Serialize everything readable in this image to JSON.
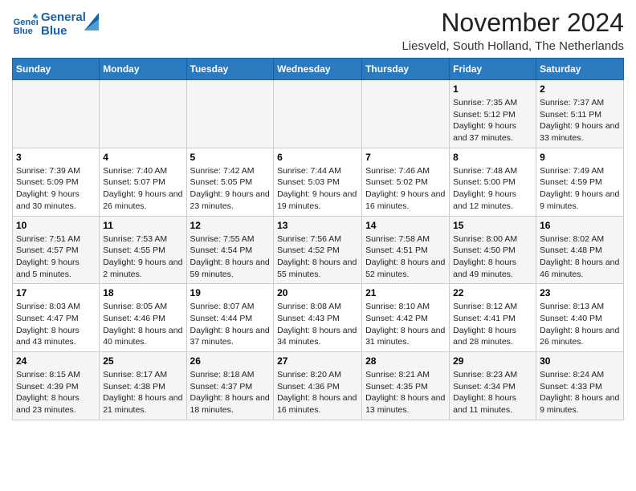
{
  "logo": {
    "text_general": "General",
    "text_blue": "Blue"
  },
  "header": {
    "month_title": "November 2024",
    "location": "Liesveld, South Holland, The Netherlands"
  },
  "weekdays": [
    "Sunday",
    "Monday",
    "Tuesday",
    "Wednesday",
    "Thursday",
    "Friday",
    "Saturday"
  ],
  "weeks": [
    [
      {
        "day": "",
        "info": ""
      },
      {
        "day": "",
        "info": ""
      },
      {
        "day": "",
        "info": ""
      },
      {
        "day": "",
        "info": ""
      },
      {
        "day": "",
        "info": ""
      },
      {
        "day": "1",
        "info": "Sunrise: 7:35 AM\nSunset: 5:12 PM\nDaylight: 9 hours and 37 minutes."
      },
      {
        "day": "2",
        "info": "Sunrise: 7:37 AM\nSunset: 5:11 PM\nDaylight: 9 hours and 33 minutes."
      }
    ],
    [
      {
        "day": "3",
        "info": "Sunrise: 7:39 AM\nSunset: 5:09 PM\nDaylight: 9 hours and 30 minutes."
      },
      {
        "day": "4",
        "info": "Sunrise: 7:40 AM\nSunset: 5:07 PM\nDaylight: 9 hours and 26 minutes."
      },
      {
        "day": "5",
        "info": "Sunrise: 7:42 AM\nSunset: 5:05 PM\nDaylight: 9 hours and 23 minutes."
      },
      {
        "day": "6",
        "info": "Sunrise: 7:44 AM\nSunset: 5:03 PM\nDaylight: 9 hours and 19 minutes."
      },
      {
        "day": "7",
        "info": "Sunrise: 7:46 AM\nSunset: 5:02 PM\nDaylight: 9 hours and 16 minutes."
      },
      {
        "day": "8",
        "info": "Sunrise: 7:48 AM\nSunset: 5:00 PM\nDaylight: 9 hours and 12 minutes."
      },
      {
        "day": "9",
        "info": "Sunrise: 7:49 AM\nSunset: 4:59 PM\nDaylight: 9 hours and 9 minutes."
      }
    ],
    [
      {
        "day": "10",
        "info": "Sunrise: 7:51 AM\nSunset: 4:57 PM\nDaylight: 9 hours and 5 minutes."
      },
      {
        "day": "11",
        "info": "Sunrise: 7:53 AM\nSunset: 4:55 PM\nDaylight: 9 hours and 2 minutes."
      },
      {
        "day": "12",
        "info": "Sunrise: 7:55 AM\nSunset: 4:54 PM\nDaylight: 8 hours and 59 minutes."
      },
      {
        "day": "13",
        "info": "Sunrise: 7:56 AM\nSunset: 4:52 PM\nDaylight: 8 hours and 55 minutes."
      },
      {
        "day": "14",
        "info": "Sunrise: 7:58 AM\nSunset: 4:51 PM\nDaylight: 8 hours and 52 minutes."
      },
      {
        "day": "15",
        "info": "Sunrise: 8:00 AM\nSunset: 4:50 PM\nDaylight: 8 hours and 49 minutes."
      },
      {
        "day": "16",
        "info": "Sunrise: 8:02 AM\nSunset: 4:48 PM\nDaylight: 8 hours and 46 minutes."
      }
    ],
    [
      {
        "day": "17",
        "info": "Sunrise: 8:03 AM\nSunset: 4:47 PM\nDaylight: 8 hours and 43 minutes."
      },
      {
        "day": "18",
        "info": "Sunrise: 8:05 AM\nSunset: 4:46 PM\nDaylight: 8 hours and 40 minutes."
      },
      {
        "day": "19",
        "info": "Sunrise: 8:07 AM\nSunset: 4:44 PM\nDaylight: 8 hours and 37 minutes."
      },
      {
        "day": "20",
        "info": "Sunrise: 8:08 AM\nSunset: 4:43 PM\nDaylight: 8 hours and 34 minutes."
      },
      {
        "day": "21",
        "info": "Sunrise: 8:10 AM\nSunset: 4:42 PM\nDaylight: 8 hours and 31 minutes."
      },
      {
        "day": "22",
        "info": "Sunrise: 8:12 AM\nSunset: 4:41 PM\nDaylight: 8 hours and 28 minutes."
      },
      {
        "day": "23",
        "info": "Sunrise: 8:13 AM\nSunset: 4:40 PM\nDaylight: 8 hours and 26 minutes."
      }
    ],
    [
      {
        "day": "24",
        "info": "Sunrise: 8:15 AM\nSunset: 4:39 PM\nDaylight: 8 hours and 23 minutes."
      },
      {
        "day": "25",
        "info": "Sunrise: 8:17 AM\nSunset: 4:38 PM\nDaylight: 8 hours and 21 minutes."
      },
      {
        "day": "26",
        "info": "Sunrise: 8:18 AM\nSunset: 4:37 PM\nDaylight: 8 hours and 18 minutes."
      },
      {
        "day": "27",
        "info": "Sunrise: 8:20 AM\nSunset: 4:36 PM\nDaylight: 8 hours and 16 minutes."
      },
      {
        "day": "28",
        "info": "Sunrise: 8:21 AM\nSunset: 4:35 PM\nDaylight: 8 hours and 13 minutes."
      },
      {
        "day": "29",
        "info": "Sunrise: 8:23 AM\nSunset: 4:34 PM\nDaylight: 8 hours and 11 minutes."
      },
      {
        "day": "30",
        "info": "Sunrise: 8:24 AM\nSunset: 4:33 PM\nDaylight: 8 hours and 9 minutes."
      }
    ]
  ]
}
